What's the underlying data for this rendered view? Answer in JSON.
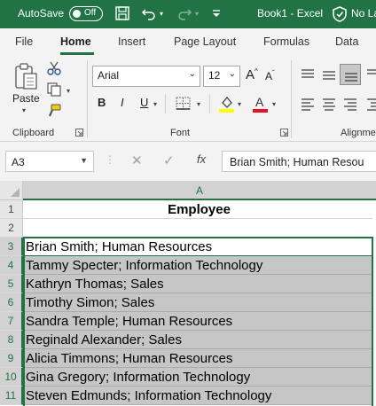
{
  "title_bar": {
    "autosave_label": "AutoSave",
    "autosave_state": "Off",
    "book_title": "Book1  -  Excel",
    "sensitivity_label": "No La"
  },
  "tabs": [
    "File",
    "Home",
    "Insert",
    "Page Layout",
    "Formulas",
    "Data"
  ],
  "active_tab": "Home",
  "ribbon": {
    "clipboard": {
      "paste_label": "Paste",
      "group_label": "Clipboard"
    },
    "font": {
      "font_name": "Arial",
      "font_size": "12",
      "bold": "B",
      "italic": "I",
      "underline": "U",
      "group_label": "Font",
      "font_color": "#e81123",
      "highlight_color": "#ffff00"
    },
    "alignment": {
      "group_label": "Alignme"
    }
  },
  "formula_bar": {
    "name_box": "A3",
    "fx_label": "fx",
    "formula": "Brian Smith; Human Resou"
  },
  "grid": {
    "column_header": "A",
    "rows": [
      {
        "num": "1",
        "value": "Employee"
      },
      {
        "num": "2",
        "value": ""
      },
      {
        "num": "3",
        "value": "Brian Smith; Human Resources"
      },
      {
        "num": "4",
        "value": "Tammy Specter; Information Technology"
      },
      {
        "num": "5",
        "value": "Kathryn Thomas; Sales"
      },
      {
        "num": "6",
        "value": "Timothy Simon; Sales"
      },
      {
        "num": "7",
        "value": "Sandra Temple; Human Resources"
      },
      {
        "num": "8",
        "value": "Reginald Alexander; Sales"
      },
      {
        "num": "9",
        "value": "Alicia Timmons; Human Resources"
      },
      {
        "num": "10",
        "value": "Gina Gregory; Information Technology"
      },
      {
        "num": "11",
        "value": "Steven Edmunds; Information Technology"
      }
    ]
  },
  "colors": {
    "accent": "#217346",
    "selection": "#c6c6c6"
  }
}
